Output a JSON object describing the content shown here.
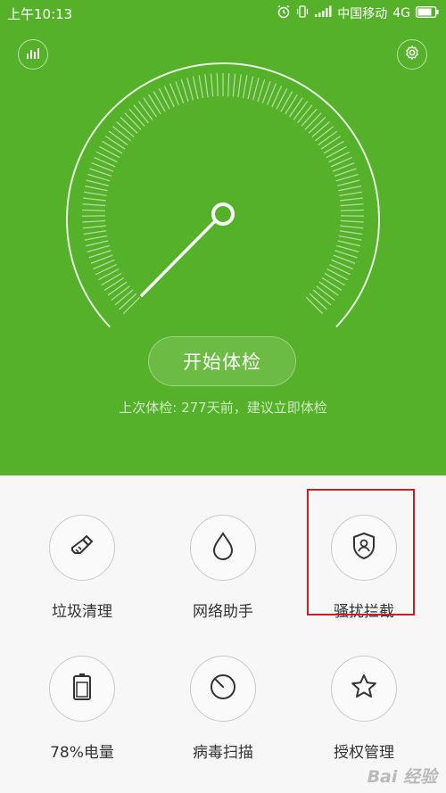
{
  "status_bar": {
    "time": "上午10:13",
    "carrier": "中国移动",
    "network": "4G"
  },
  "header": {
    "left_icon": "stats-bars-icon",
    "right_icon": "gear-icon"
  },
  "checkup": {
    "button_label": "开始体检",
    "last_check_text": "上次体检: 277天前，建议立即体检"
  },
  "tools": [
    {
      "label": "垃圾清理",
      "icon": "broom-icon"
    },
    {
      "label": "网络助手",
      "icon": "droplet-icon"
    },
    {
      "label": "骚扰拦截",
      "icon": "shield-user-icon"
    },
    {
      "label": "78%电量",
      "icon": "battery-icon"
    },
    {
      "label": "病毒扫描",
      "icon": "scan-dial-icon"
    },
    {
      "label": "授权管理",
      "icon": "star-icon"
    }
  ],
  "watermark": {
    "text": "Bai 经验"
  },
  "colors": {
    "primary_green": "#55b12a",
    "highlight_red": "#c8202b"
  }
}
